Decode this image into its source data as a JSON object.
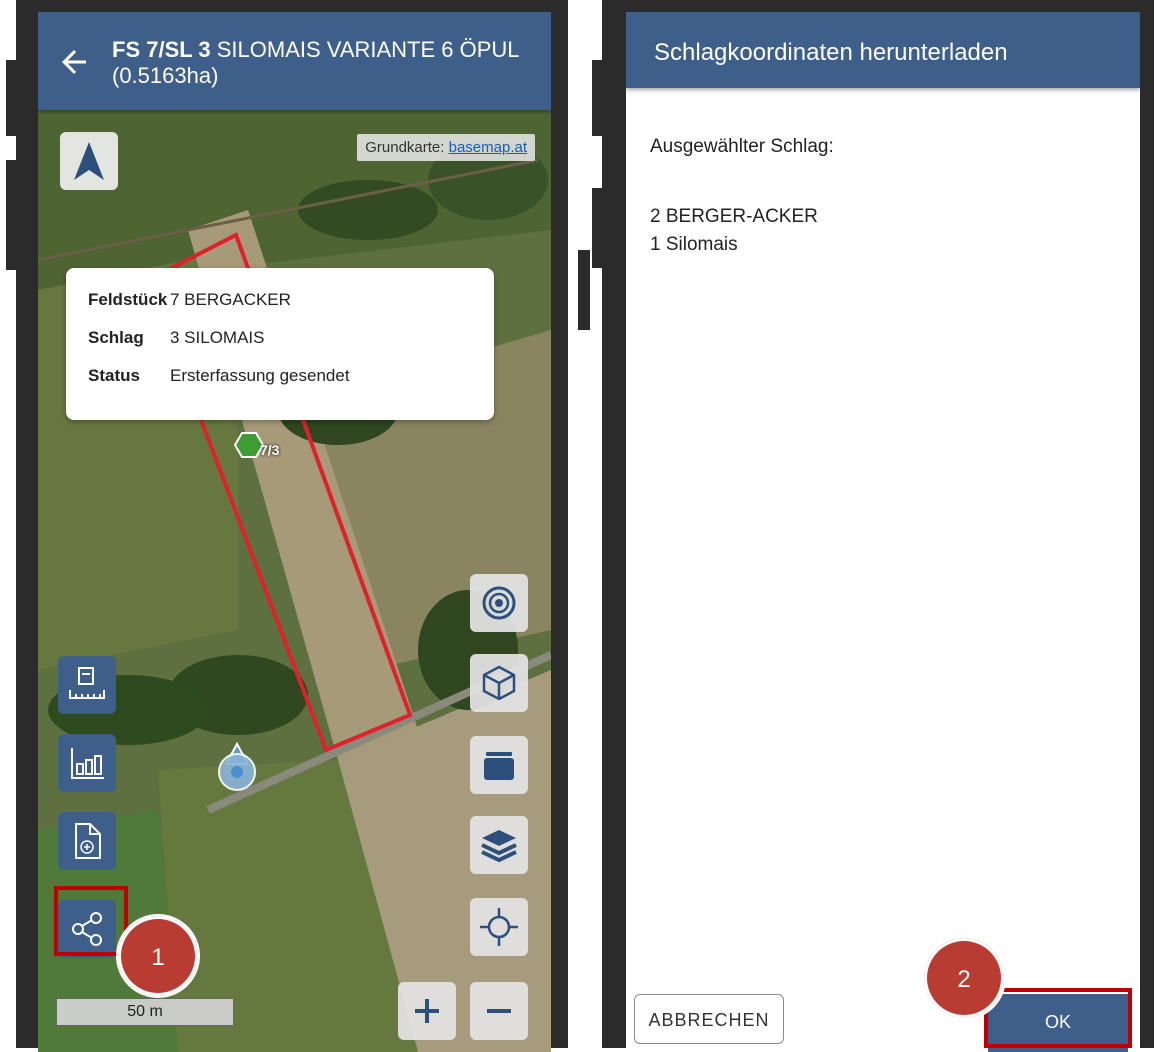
{
  "left_screen": {
    "appbar": {
      "title_bold": "FS 7/SL 3",
      "title_rest": " SILOMAIS VARIANTE 6 ÖPUL",
      "subtitle": "(0.5163ha)"
    },
    "attribution": {
      "prefix": "Grundkarte: ",
      "link": "basemap.at"
    },
    "info_card": {
      "rows": [
        {
          "key": "Feldstück",
          "value": "7 BERGACKER"
        },
        {
          "key": "Schlag",
          "value": "3 SILOMAIS"
        },
        {
          "key": "Status",
          "value": "Ersterfassung gesendet"
        }
      ]
    },
    "map_marker": "7/3",
    "scale_label": "50 m",
    "left_tools": [
      "measure-icon",
      "chart-icon",
      "new-document-icon",
      "share-icon"
    ],
    "right_tools": [
      "target-icon",
      "cube-icon",
      "folder-icon",
      "layers-icon",
      "locate-icon"
    ],
    "zoom": {
      "in": "+",
      "out": "−"
    },
    "step_badge": "1"
  },
  "right_screen": {
    "appbar_title": "Schlagkoordinaten herunterladen",
    "label": "Ausgewählter Schlag:",
    "line1": "2 BERGER-ACKER",
    "line2": "1 Silomais",
    "cancel_label": "ABBRECHEN",
    "ok_label": "OK",
    "step_badge": "2"
  },
  "colors": {
    "accent": "#3d5f8a",
    "highlight": "#c00000",
    "badge": "#b83c32",
    "field_outline": "#e0202a"
  }
}
